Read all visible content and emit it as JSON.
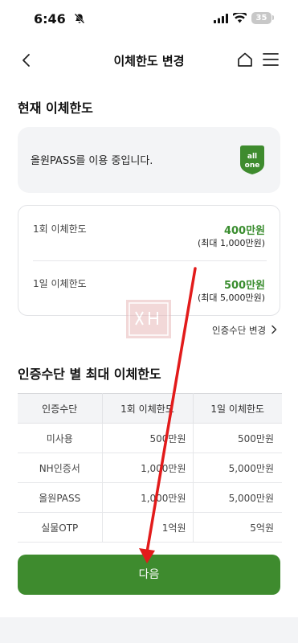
{
  "status_bar": {
    "time": "6:46",
    "battery": "35"
  },
  "nav": {
    "title": "이체한도 변경"
  },
  "current_section": {
    "title": "현재 이체한도",
    "auth_message": "올원PASS를 이용 중입니다.",
    "logo_text": "all one"
  },
  "limits": [
    {
      "label": "1회 이체한도",
      "value": "400만원",
      "max": "(최대 1,000만원)"
    },
    {
      "label": "1일 이체한도",
      "value": "500만원",
      "max": "(최대 5,000만원)"
    }
  ],
  "change_auth_link": "인증수단 변경",
  "table_section": {
    "title": "인증수단 별 최대 이체한도",
    "headers": [
      "인증수단",
      "1회 이체한도",
      "1일 이체한도"
    ],
    "rows": [
      [
        "미사용",
        "500만원",
        "500만원"
      ],
      [
        "NH인증서",
        "1,000만원",
        "5,000만원"
      ],
      [
        "올원PASS",
        "1,000만원",
        "5,000만원"
      ],
      [
        "실물OTP",
        "1억원",
        "5억원"
      ]
    ]
  },
  "next_button": "다음",
  "colors": {
    "brand_green": "#3e8b2e",
    "value_green": "#3a8d2f",
    "annotation_red": "#e21b1b"
  },
  "icons": [
    "bell-slash-icon",
    "signal-icon",
    "wifi-icon",
    "battery-icon",
    "back-icon",
    "home-icon",
    "menu-icon",
    "all-one-logo-icon",
    "chevron-right-icon"
  ]
}
